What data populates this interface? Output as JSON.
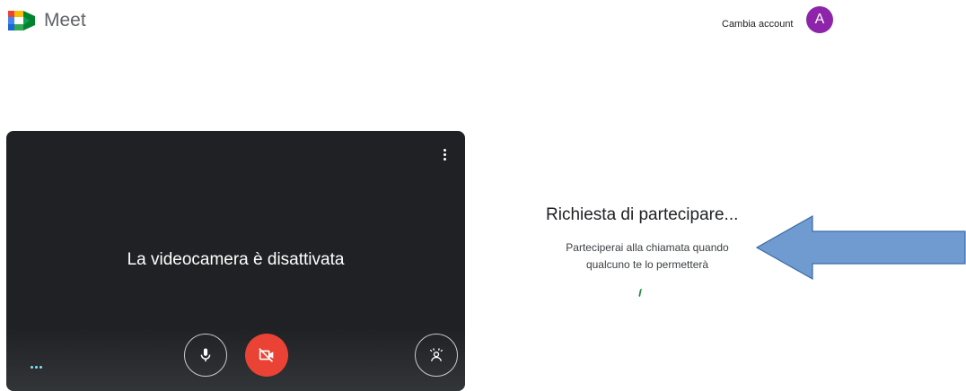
{
  "header": {
    "app_name": "Meet",
    "switch_account_label": "Cambia account",
    "avatar_initial": "A",
    "avatar_color": "#8e24aa"
  },
  "preview": {
    "camera_off_text": "La videocamera è disattivata",
    "icons": {
      "more": "more-vert-icon",
      "mic": "microphone-icon",
      "camera": "camera-off-icon",
      "effects": "visual-effects-icon"
    },
    "camera_button_color": "#ea4335"
  },
  "join": {
    "title": "Richiesta di partecipare...",
    "subtitle_line1": "Parteciperai alla chiamata quando",
    "subtitle_line2": "qualcuno te lo permetterà"
  },
  "annotation": {
    "arrow_color": "#6f9bd1",
    "arrow_border": "#3d6aa6"
  }
}
